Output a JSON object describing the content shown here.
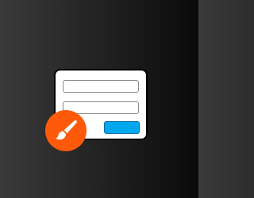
{
  "icon": {
    "name": "form-builder-app-icon",
    "background_gradient": [
      "#3a3a3a",
      "#0a0a0a"
    ],
    "card_color": "#ffffff",
    "field_border_color": "#8a8a8a",
    "button_color": "#00a8f0",
    "badge_color": "#ff5a0a",
    "badge_icon": "paintbrush-icon"
  }
}
